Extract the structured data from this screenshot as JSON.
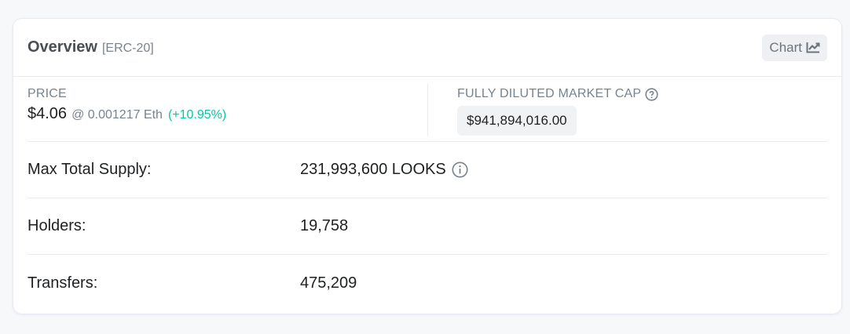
{
  "header": {
    "title": "Overview",
    "subtitle": "[ERC-20]",
    "chart_button_label": "Chart",
    "chart_icon": "line-chart-icon"
  },
  "price": {
    "label": "PRICE",
    "value": "$4.06",
    "eth": "@ 0.001217 Eth",
    "change": "(+10.95%)",
    "change_color": "#00c9a7"
  },
  "market_cap": {
    "label": "FULLY DILUTED MARKET CAP",
    "help_icon": "question-circle-icon",
    "value": "$941,894,016.00"
  },
  "rows": [
    {
      "label": "Max Total Supply:",
      "value": "231,993,600 LOOKS",
      "icon": "info-circle-icon"
    },
    {
      "label": "Holders:",
      "value": "19,758"
    },
    {
      "label": "Transfers:",
      "value": "475,209"
    }
  ]
}
